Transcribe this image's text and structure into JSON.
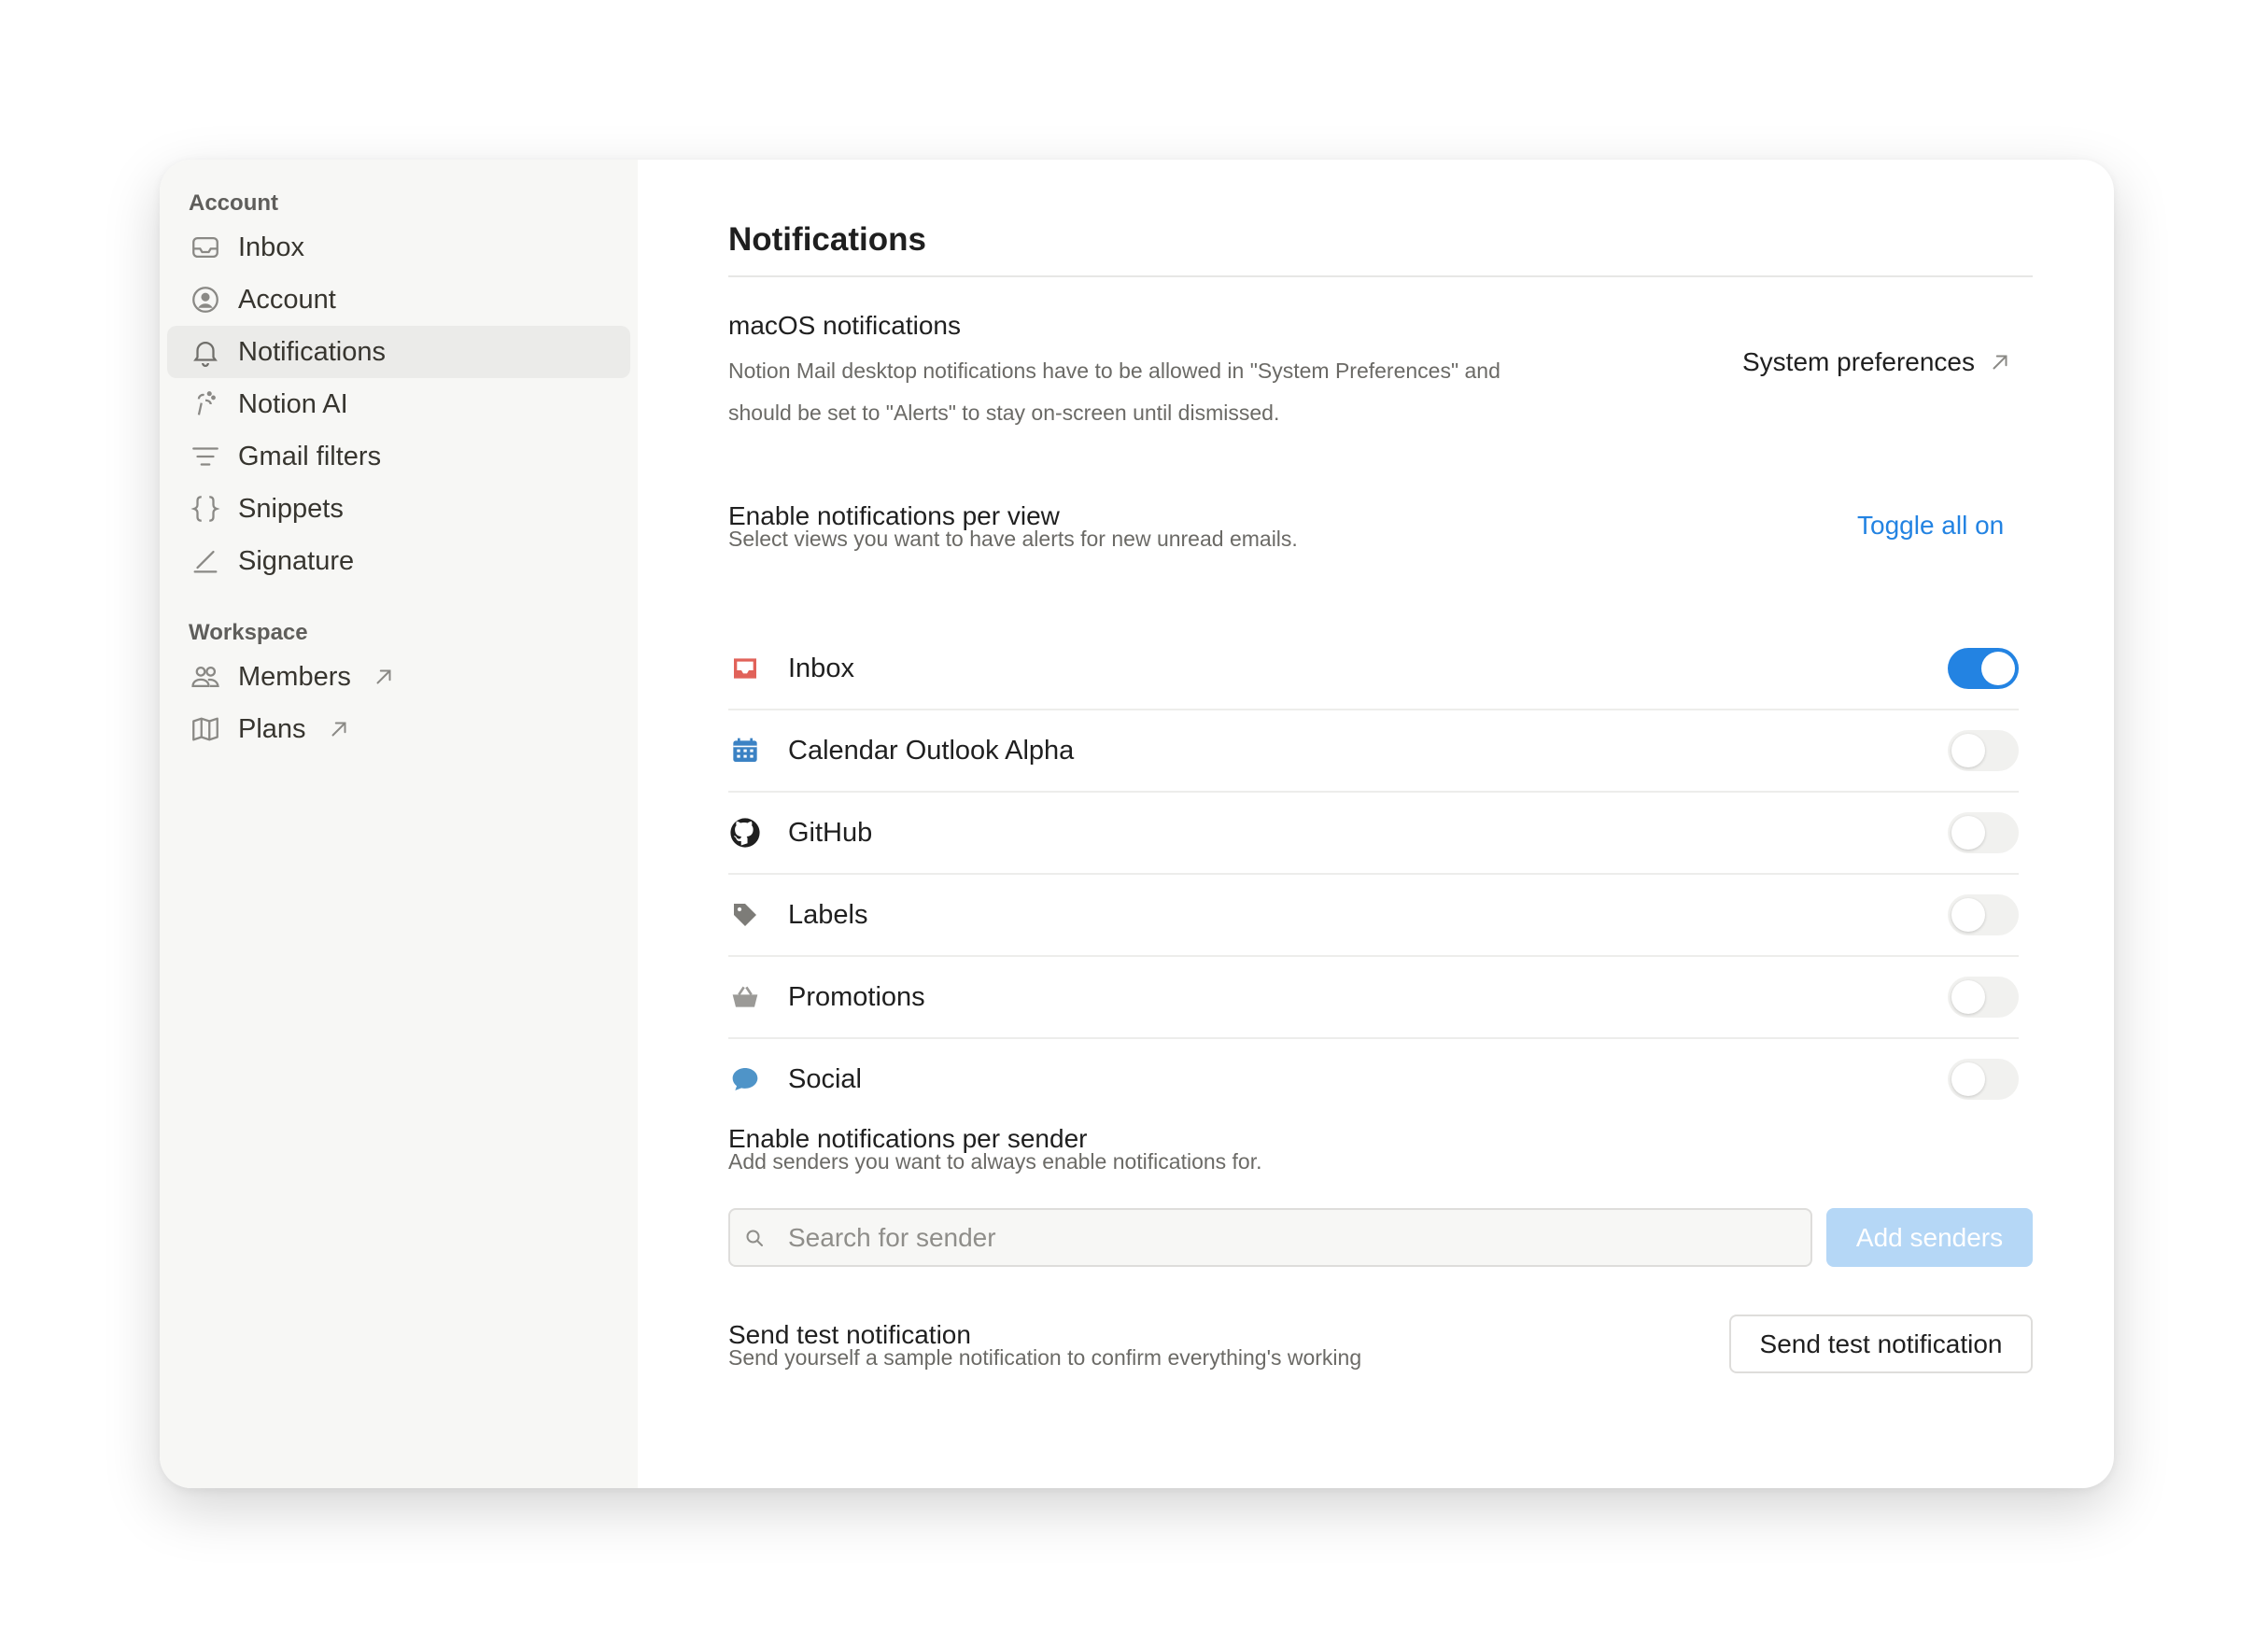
{
  "sidebar": {
    "account_title": "Account",
    "account_items": [
      {
        "label": "Inbox",
        "icon": "inbox-icon"
      },
      {
        "label": "Account",
        "icon": "user-circle-icon"
      },
      {
        "label": "Notifications",
        "icon": "bell-icon",
        "active": true
      },
      {
        "label": "Notion AI",
        "icon": "notion-ai-icon"
      },
      {
        "label": "Gmail filters",
        "icon": "filter-icon"
      },
      {
        "label": "Snippets",
        "icon": "braces-icon"
      },
      {
        "label": "Signature",
        "icon": "signature-icon"
      }
    ],
    "workspace_title": "Workspace",
    "workspace_items": [
      {
        "label": "Members",
        "icon": "people-icon",
        "external": true
      },
      {
        "label": "Plans",
        "icon": "map-icon",
        "external": true
      }
    ]
  },
  "main": {
    "title": "Notifications",
    "macos": {
      "title": "macOS notifications",
      "desc_line1": "Notion Mail desktop notifications have to be allowed in \"System Preferences\" and",
      "desc_line2": "should be set to \"Alerts\" to stay on-screen until dismissed.",
      "link_label": "System preferences"
    },
    "per_view": {
      "title": "Enable notifications per view",
      "desc": "Select views you want to have alerts for new unread emails.",
      "toggle_all_label": "Toggle all on",
      "views": [
        {
          "label": "Inbox",
          "icon": "inbox-tray-icon",
          "enabled": true
        },
        {
          "label": "Calendar Outlook Alpha",
          "icon": "calendar-icon",
          "enabled": false
        },
        {
          "label": "GitHub",
          "icon": "github-icon",
          "enabled": false
        },
        {
          "label": "Labels",
          "icon": "tag-icon",
          "enabled": false
        },
        {
          "label": "Promotions",
          "icon": "basket-icon",
          "enabled": false
        },
        {
          "label": "Social",
          "icon": "chat-bubble-icon",
          "enabled": false
        }
      ]
    },
    "per_sender": {
      "title": "Enable notifications per sender",
      "desc": "Add senders you want to always enable notifications for.",
      "search_placeholder": "Search for sender",
      "search_value": "",
      "add_button_label": "Add senders"
    },
    "test": {
      "title": "Send test notification",
      "desc": "Send yourself a sample notification to confirm everything's working",
      "button_label": "Send test notification"
    }
  },
  "colors": {
    "accent": "#2383e2",
    "sidebar_bg": "#f7f7f5",
    "active_item_bg": "#ebebe9",
    "add_button_disabled": "#b5d7f6",
    "inbox_red": "#e16259",
    "calendar_blue": "#3b82c4"
  }
}
